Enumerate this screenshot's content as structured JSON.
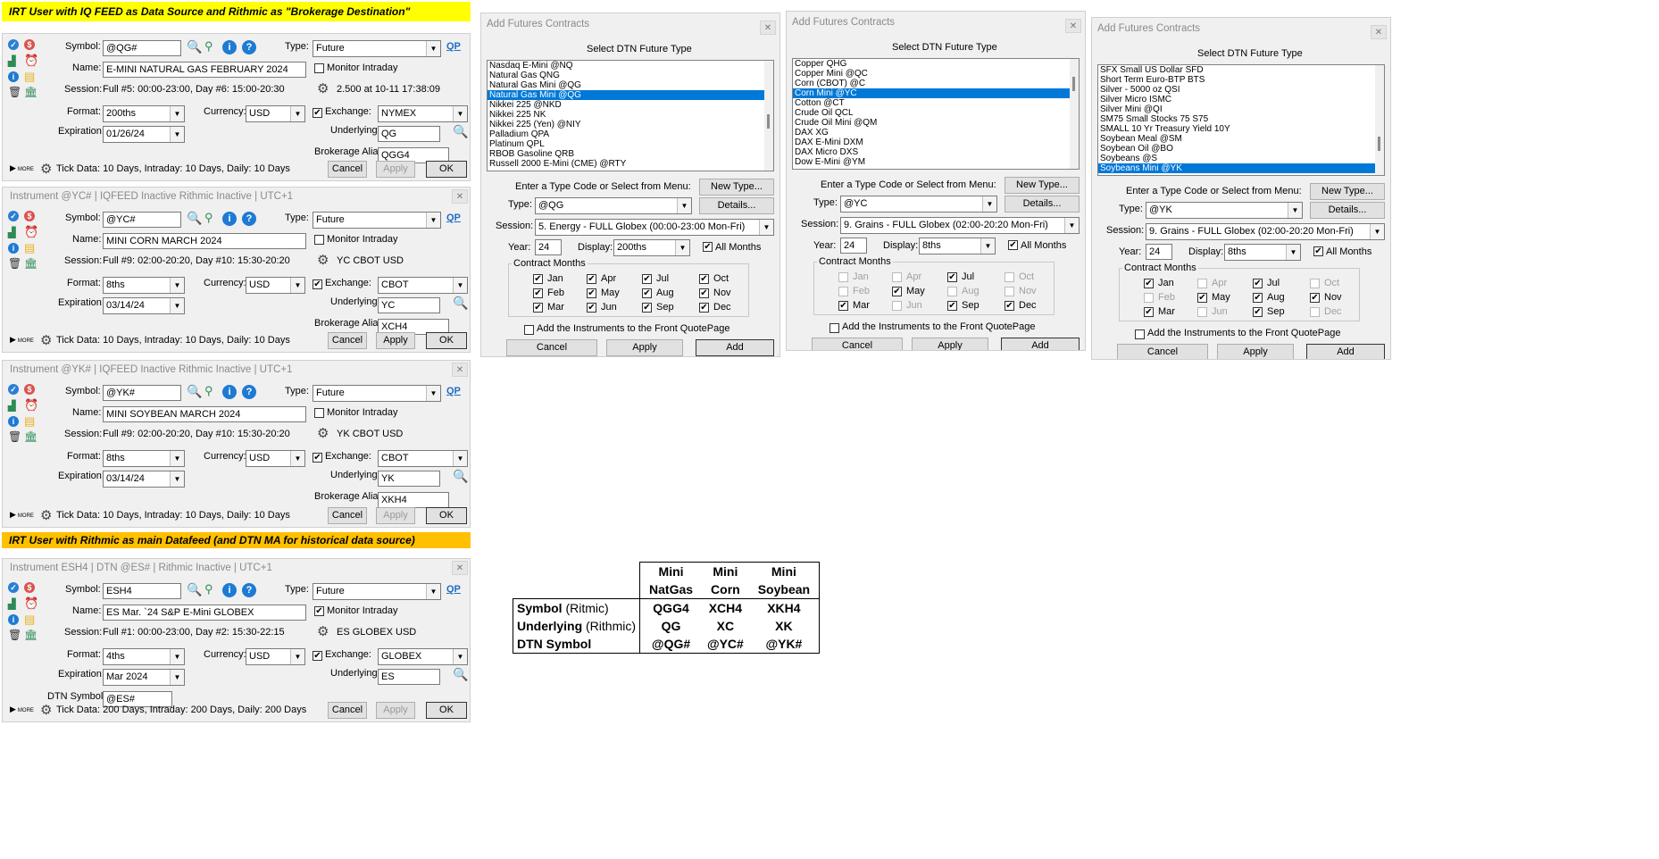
{
  "banners": {
    "iq": "IRT User with IQ FEED as Data Source and  Rithmic as \"Brokerage Destination\"",
    "rithmic": "IRT User with Rithmic as main Datafeed (and DTN MA for historical data source)"
  },
  "colors": {
    "banner_yellow": "#ffff00",
    "banner_orange": "#ffc000",
    "selection": "#0078d7",
    "link_blue": "#1e6cc6"
  },
  "labels": {
    "symbol": "Symbol:",
    "type": "Type:",
    "name": "Name:",
    "session": "Session:",
    "format": "Format:",
    "currency": "Currency:",
    "exchange": "Exchange:",
    "expiration": "Expiration:",
    "underlying": "Underlying:",
    "brokerage_alias": "Brokerage Alias:",
    "monitor_intraday": "Monitor Intraday",
    "qp": "QP",
    "more": "MORE",
    "cancel": "Cancel",
    "apply": "Apply",
    "ok": "OK",
    "dtn_symbol": "DTN Symbol:"
  },
  "instruments": [
    {
      "title": "",
      "symbol": "@QG#",
      "type": "Future",
      "name": "E-MINI NATURAL GAS FEBRUARY 2024",
      "session": "Full #5: 00:00-23:00, Day #6: 15:00-20:30",
      "session_info": "2.500 at 10-11 17:38:09",
      "format": "200ths",
      "currency": "USD",
      "exchange": "NYMEX",
      "expiration": "01/26/24",
      "underlying": "QG",
      "brokerage_alias": "QGG4",
      "tick": "Tick Data: 10 Days, Intraday: 10 Days, Daily: 10 Days",
      "apply_enabled": false
    },
    {
      "title": "Instrument @YC# | IQFEED Inactive  Rithmic Inactive | UTC+1",
      "symbol": "@YC#",
      "type": "Future",
      "name": "MINI CORN MARCH 2024",
      "session": "Full #9: 02:00-20:20, Day #10: 15:30-20:20",
      "session_info": "YC CBOT USD",
      "format": "8ths",
      "currency": "USD",
      "exchange": "CBOT",
      "expiration": "03/14/24",
      "underlying": "YC",
      "brokerage_alias": "XCH4",
      "tick": "Tick Data: 10 Days, Intraday: 10 Days, Daily: 10 Days",
      "apply_enabled": true
    },
    {
      "title": "Instrument @YK# | IQFEED Inactive  Rithmic Inactive | UTC+1",
      "symbol": "@YK#",
      "type": "Future",
      "name": "MINI SOYBEAN MARCH 2024",
      "session": "Full #9: 02:00-20:20, Day #10: 15:30-20:20",
      "session_info": "YK CBOT USD",
      "format": "8ths",
      "currency": "USD",
      "exchange": "CBOT",
      "expiration": "03/14/24",
      "underlying": "YK",
      "brokerage_alias": "XKH4",
      "tick": "Tick Data: 10 Days, Intraday: 10 Days, Daily: 10 Days",
      "apply_enabled": false
    },
    {
      "title": "Instrument ESH4 | DTN @ES# | Rithmic Inactive | UTC+1",
      "symbol": "ESH4",
      "type": "Future",
      "name": "ES Mar. `24 S&P E-Mini GLOBEX",
      "session": "Full #1: 00:00-23:00, Day #2: 15:30-22:15",
      "session_info": "ES GLOBEX USD",
      "format": "4ths",
      "currency": "USD",
      "exchange": "GLOBEX",
      "expiration": "Mar 2024",
      "underlying": "ES",
      "dtn_symbol": "@ES#",
      "tick": "Tick Data: 200 Days, Intraday: 200 Days, Daily: 200 Days",
      "apply_enabled": false
    }
  ],
  "dialog_labels": {
    "title": "Add Futures Contracts",
    "header": "Select DTN Future Type",
    "enter_type": "Enter a Type Code or Select from Menu:",
    "new_type": "New Type...",
    "type": "Type:",
    "details": "Details...",
    "session": "Session:",
    "year": "Year:",
    "display": "Display:",
    "all_months": "All Months",
    "contract_months": "Contract Months",
    "add_front": "Add the Instruments to the Front QuotePage",
    "cancel": "Cancel",
    "apply": "Apply",
    "add": "Add"
  },
  "dialogs": [
    {
      "items": [
        "Nasdaq E-Mini  @NQ",
        "Natural Gas  QNG",
        "Natural Gas Mini  @QG",
        "Natural Gas Mini  @QG",
        "Nikkei 225  @NKD",
        "Nikkei 225  NK",
        "Nikkei 225 (Yen)  @NIY",
        "Palladium  QPA",
        "Platinum  QPL",
        "RBOB Gasoline  QRB",
        "Russell 2000 E-Mini (CME)  @RTY"
      ],
      "selected_index": 3,
      "type": "@QG",
      "session": "5. Energy - FULL Globex (00:00-23:00 Mon-Fri)",
      "year": "24",
      "display": "200ths",
      "months": [
        [
          "Jan",
          true,
          true
        ],
        [
          "Apr",
          true,
          true
        ],
        [
          "Jul",
          true,
          true
        ],
        [
          "Oct",
          true,
          true
        ],
        [
          "Feb",
          true,
          true
        ],
        [
          "May",
          true,
          true
        ],
        [
          "Aug",
          true,
          true
        ],
        [
          "Nov",
          true,
          true
        ],
        [
          "Mar",
          true,
          true
        ],
        [
          "Jun",
          true,
          true
        ],
        [
          "Sep",
          true,
          true
        ],
        [
          "Dec",
          true,
          true
        ]
      ]
    },
    {
      "items": [
        "Copper  QHG",
        "Copper Mini  @QC",
        "Corn (CBOT)  @C",
        "Corn Mini  @YC",
        "Cotton  @CT",
        "Crude Oil  QCL",
        "Crude Oil Mini  @QM",
        "DAX  XG",
        "DAX E-Mini  DXM",
        "DAX Micro  DXS",
        "Dow E-Mini  @YM"
      ],
      "selected_index": 3,
      "type": "@YC",
      "session": "9. Grains - FULL Globex (02:00-20:20 Mon-Fri)",
      "year": "24",
      "display": "8ths",
      "months": [
        [
          "Jan",
          false,
          false
        ],
        [
          "Apr",
          false,
          false
        ],
        [
          "Jul",
          true,
          true
        ],
        [
          "Oct",
          false,
          false
        ],
        [
          "Feb",
          false,
          false
        ],
        [
          "May",
          true,
          true
        ],
        [
          "Aug",
          false,
          false
        ],
        [
          "Nov",
          false,
          false
        ],
        [
          "Mar",
          true,
          true
        ],
        [
          "Jun",
          false,
          false
        ],
        [
          "Sep",
          true,
          true
        ],
        [
          "Dec",
          true,
          true
        ]
      ]
    },
    {
      "items": [
        "SFX Small US Dollar  SFD",
        "Short Term Euro-BTP  BTS",
        "Silver - 5000 oz  QSI",
        "Silver Micro  ISMC",
        "Silver Mini  @QI",
        "SM75 Small Stocks 75  S75",
        "SMALL 10 Yr Treasury Yield  10Y",
        "Soybean Meal  @SM",
        "Soybean Oil  @BO",
        "Soybeans  @S",
        "Soybeans Mini  @YK"
      ],
      "selected_index": 10,
      "type": "@YK",
      "session": "9. Grains - FULL Globex (02:00-20:20 Mon-Fri)",
      "year": "24",
      "display": "8ths",
      "months": [
        [
          "Jan",
          true,
          true
        ],
        [
          "Apr",
          false,
          false
        ],
        [
          "Jul",
          true,
          true
        ],
        [
          "Oct",
          false,
          false
        ],
        [
          "Feb",
          false,
          false
        ],
        [
          "May",
          true,
          true
        ],
        [
          "Aug",
          true,
          true
        ],
        [
          "Nov",
          true,
          true
        ],
        [
          "Mar",
          true,
          true
        ],
        [
          "Jun",
          false,
          false
        ],
        [
          "Sep",
          true,
          true
        ],
        [
          "Dec",
          false,
          false
        ]
      ]
    }
  ],
  "comparison": {
    "headers": [
      [
        "Mini",
        "NatGas"
      ],
      [
        "Mini",
        "Corn"
      ],
      [
        "Mini",
        "Soybean"
      ]
    ],
    "rows": [
      {
        "label": "Symbol",
        "sub": " (Ritmic)",
        "values": [
          "QGG4",
          "XCH4",
          "XKH4"
        ]
      },
      {
        "label": "Underlying",
        "sub": "  (Rithmic)",
        "values": [
          "QG",
          "XC",
          "XK"
        ]
      },
      {
        "label": "DTN Symbol",
        "sub": "",
        "values": [
          "@QG#",
          "@YC#",
          "@YK#"
        ]
      }
    ]
  }
}
